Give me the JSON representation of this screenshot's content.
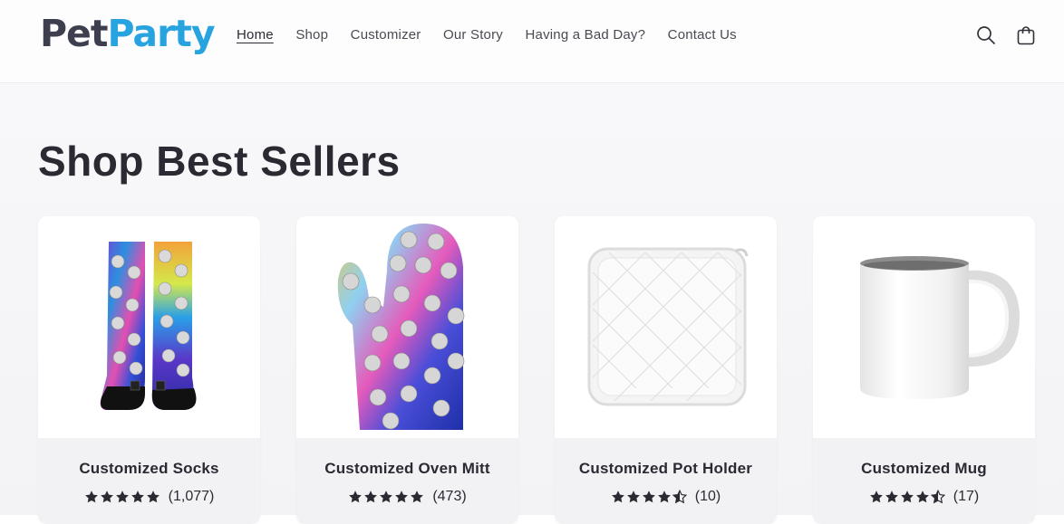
{
  "brand": {
    "name_part1": "Pet",
    "name_part2": "Party",
    "colors": {
      "dark": "#3d3f4f",
      "blue": "#27a3e0"
    }
  },
  "nav": {
    "items": [
      {
        "label": "Home",
        "active": true
      },
      {
        "label": "Shop",
        "active": false
      },
      {
        "label": "Customizer",
        "active": false
      },
      {
        "label": "Our Story",
        "active": false
      },
      {
        "label": "Having a Bad Day?",
        "active": false
      },
      {
        "label": "Contact Us",
        "active": false
      }
    ]
  },
  "header_icons": {
    "search": "search-icon",
    "cart": "cart-bag-icon"
  },
  "section": {
    "title": "Shop Best Sellers"
  },
  "products": [
    {
      "name": "Customized Socks",
      "rating": 5,
      "reviews": "(1,077)",
      "image": "galaxy-cat-socks"
    },
    {
      "name": "Customized Oven Mitt",
      "rating": 5,
      "reviews": "(473)",
      "image": "galaxy-cat-oven-mitt"
    },
    {
      "name": "Customized Pot Holder",
      "rating": 4.5,
      "reviews": "(10)",
      "image": "white-quilted-pot-holder"
    },
    {
      "name": "Customized Mug",
      "rating": 4.5,
      "reviews": "(17)",
      "image": "white-mug"
    }
  ]
}
